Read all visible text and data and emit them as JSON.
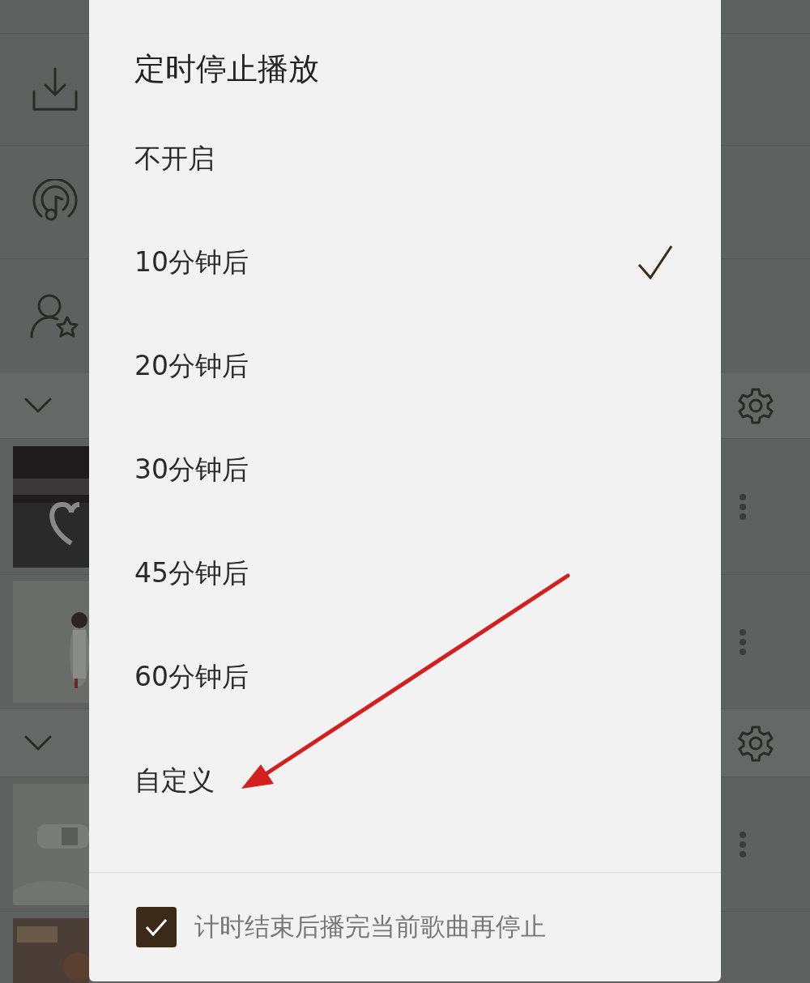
{
  "dialog": {
    "title": "定时停止播放",
    "options": [
      {
        "label": "不开启",
        "selected": false
      },
      {
        "label": "10分钟后",
        "selected": true
      },
      {
        "label": "20分钟后",
        "selected": false
      },
      {
        "label": "30分钟后",
        "selected": false
      },
      {
        "label": "45分钟后",
        "selected": false
      },
      {
        "label": "60分钟后",
        "selected": false
      },
      {
        "label": "自定义",
        "selected": false
      }
    ],
    "footer": {
      "label": "计时结束后播完当前歌曲再停止",
      "checked": true
    }
  }
}
